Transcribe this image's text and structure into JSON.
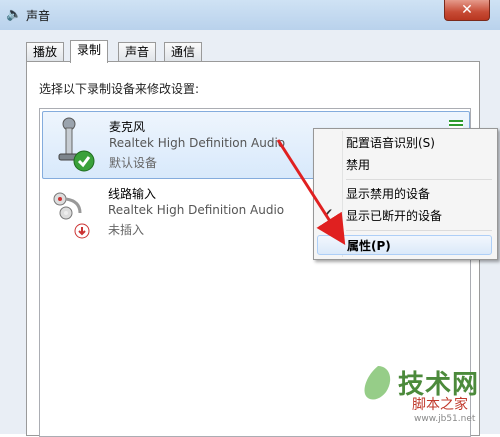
{
  "window": {
    "title": "声音",
    "close_label": "✕"
  },
  "tabs": [
    {
      "label": "播放",
      "active": false
    },
    {
      "label": "录制",
      "active": true
    },
    {
      "label": "声音",
      "active": false
    },
    {
      "label": "通信",
      "active": false
    }
  ],
  "instruction": "选择以下录制设备来修改设置:",
  "devices": [
    {
      "name": "麦克风",
      "driver": "Realtek High Definition Audio",
      "status": "默认设备",
      "selected": true,
      "icon": "microphone-icon",
      "badge": "green-check-icon"
    },
    {
      "name": "线路输入",
      "driver": "Realtek High Definition Audio",
      "status": "未插入",
      "selected": false,
      "icon": "line-in-cable-icon",
      "badge": "red-down-arrow-icon"
    }
  ],
  "context_menu": {
    "items": [
      {
        "label": "配置语音识别(S)"
      },
      {
        "label": "禁用"
      },
      {
        "label": "显示禁用的设备"
      },
      {
        "label": "显示已断开的设备",
        "checked": true
      },
      {
        "label": "属性(P)",
        "bold": true,
        "highlighted": true
      }
    ]
  },
  "watermark": {
    "text_cn": "技术网",
    "text_jb": "脚本之家",
    "url": "www.jb51.net"
  },
  "colors": {
    "accent": "#84acdd",
    "arrow": "#e02020",
    "level": "#2e9b2e",
    "close": "#c74b35"
  }
}
